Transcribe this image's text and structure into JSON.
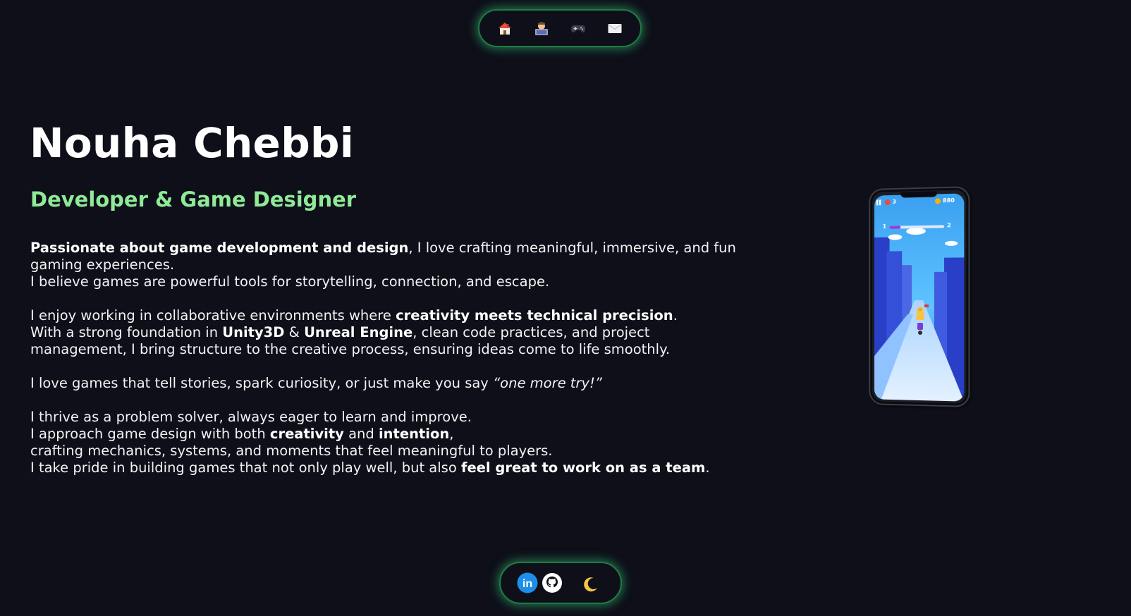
{
  "nav": {
    "items": [
      {
        "icon": "home-icon",
        "label": "Home"
      },
      {
        "icon": "developer-icon",
        "label": "About"
      },
      {
        "icon": "gamepad-icon",
        "label": "Games"
      },
      {
        "icon": "envelope-icon",
        "label": "Contact"
      }
    ]
  },
  "hero": {
    "name": "Nouha Chebbi",
    "role": "Developer & Game Designer",
    "accent_color": "#8fea98"
  },
  "bio": {
    "p1_bold": "Passionate about game development and design",
    "p1_rest": ", I love crafting meaningful, immersive, and fun gaming experiences.",
    "p1_line2": "I believe games are powerful tools for storytelling, connection, and escape.",
    "p2_a": "I enjoy working in collaborative environments where ",
    "p2_bold1": "creativity meets technical precision",
    "p2_b": ".",
    "p2_c": "With a strong foundation in ",
    "p2_bold2": "Unity3D",
    "p2_d": " & ",
    "p2_bold3": "Unreal Engine",
    "p2_e": ", clean code practices, and project management, I bring structure to the creative process, ensuring ideas come to life smoothly.",
    "p3_a": "I love games that tell stories, spark curiosity, or just make you say ",
    "p3_italic": "“one more try!”",
    "p4_line1": "I thrive as a problem solver, always eager to learn and improve.",
    "p4_a": "I approach game design with both ",
    "p4_bold1": "creativity",
    "p4_b": " and ",
    "p4_bold2": "intention",
    "p4_c": ",",
    "p4_line3": "crafting mechanics, systems, and moments that feel meaningful to players.",
    "p4_d": "I take pride in building games that not only play well, but also ",
    "p4_bold3": "feel great to work on as a team",
    "p4_e": "."
  },
  "phone": {
    "hud_lives": "3",
    "hud_coins": "880",
    "progress_start": "1",
    "progress_end": "2",
    "progress_fraction": 0.2
  },
  "dock": {
    "items": [
      {
        "icon": "linkedin-icon",
        "label": "in"
      },
      {
        "icon": "github-icon"
      },
      {
        "icon": "moon-icon"
      }
    ]
  },
  "colors": {
    "background": "#0e0f19",
    "glow": "#34d378",
    "text": "#ffffff"
  }
}
